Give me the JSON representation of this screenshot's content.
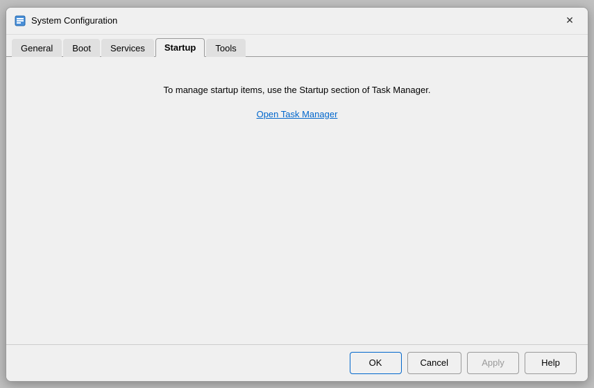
{
  "window": {
    "title": "System Configuration",
    "close_label": "✕"
  },
  "tabs": [
    {
      "id": "general",
      "label": "General",
      "active": false
    },
    {
      "id": "boot",
      "label": "Boot",
      "active": false
    },
    {
      "id": "services",
      "label": "Services",
      "active": false
    },
    {
      "id": "startup",
      "label": "Startup",
      "active": true
    },
    {
      "id": "tools",
      "label": "Tools",
      "active": false
    }
  ],
  "content": {
    "info_text": "To manage startup items, use the Startup section of Task Manager.",
    "link_text": "Open Task Manager"
  },
  "buttons": {
    "ok": "OK",
    "cancel": "Cancel",
    "apply": "Apply",
    "help": "Help"
  }
}
